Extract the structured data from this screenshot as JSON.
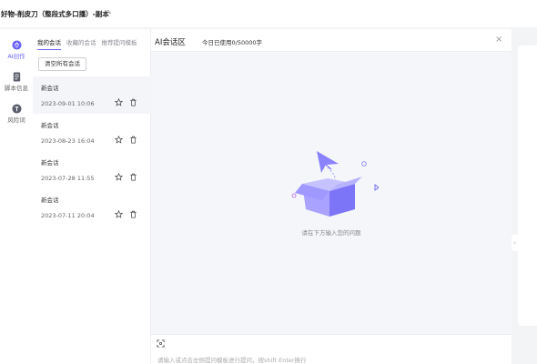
{
  "header": {
    "title": "好物-削皮刀（整段式多口播）-副本",
    "edit_icon": "pencil-icon"
  },
  "rail": {
    "items": [
      {
        "label": "AI创作",
        "icon": "ai-create-icon",
        "active": true
      },
      {
        "label": "脚本信息",
        "icon": "document-icon",
        "active": false
      },
      {
        "label": "风险词",
        "icon": "risk-words-icon",
        "active": false
      }
    ]
  },
  "conversations": {
    "tabs": [
      "我的会话",
      "收藏的会话",
      "推荐提问模板"
    ],
    "active_tab": "我的会话",
    "clear_label": "清空所有会话",
    "items": [
      {
        "name": "新会话",
        "date": "2023-09-01 10:06"
      },
      {
        "name": "新会话",
        "date": "2023-08-23 16:04"
      },
      {
        "name": "新会话",
        "date": "2023-07-28 11:55"
      },
      {
        "name": "新会话",
        "date": "2023-07-11 20:04"
      }
    ]
  },
  "chat": {
    "title": "AI会话区",
    "usage": "今日已使用0/50000字",
    "empty_hint": "请在下方输入您的问题",
    "input_placeholder": "请输入或点击左侧提问模板进行提问，按shift Enter换行"
  },
  "colors": {
    "accent": "#6b63f5",
    "illustration_light": "#a9a3ff",
    "background": "#f3f4f6"
  }
}
